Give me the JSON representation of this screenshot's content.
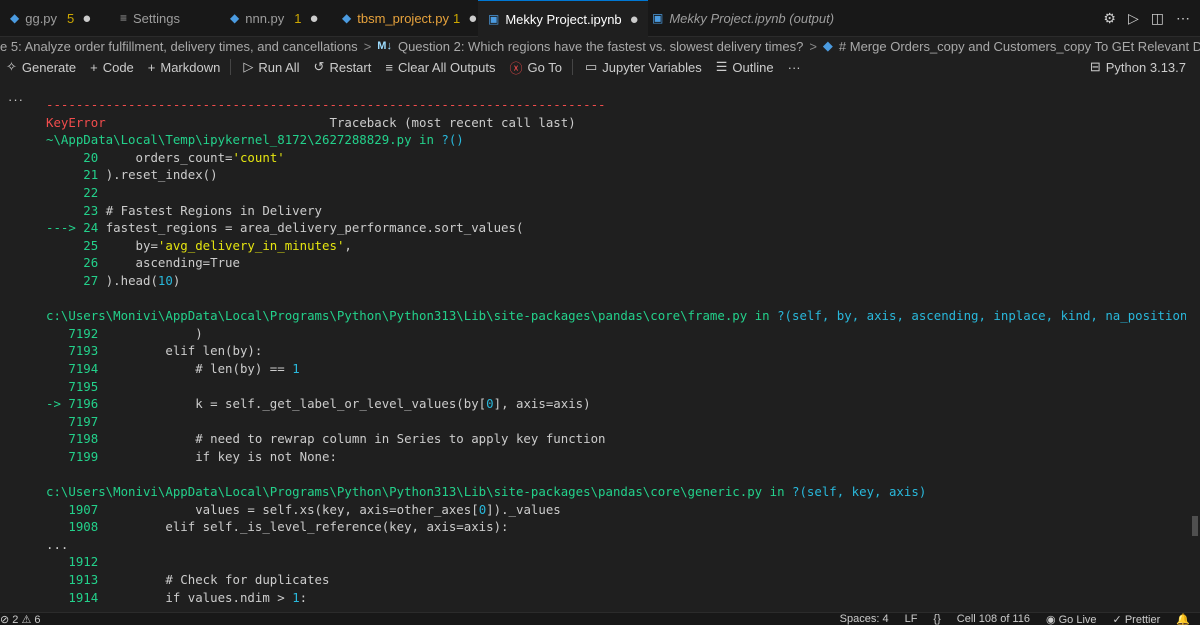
{
  "tabs": [
    {
      "label": "gg.py",
      "count": "5",
      "dot": "●",
      "icon": "python-icon",
      "active": false
    },
    {
      "label": "Settings",
      "icon": "settings-icon",
      "active": false
    },
    {
      "label": "nnn.py",
      "count": "1",
      "dot": "●",
      "icon": "python-icon",
      "active": false
    },
    {
      "label": "tbsm_project.py",
      "count": "1",
      "dot": "●",
      "icon": "python-icon",
      "active": false
    },
    {
      "label": "Mekky Project.ipynb",
      "dot": "●",
      "icon": "notebook-icon",
      "active": true
    },
    {
      "label": "Mekky Project.ipynb (output)",
      "icon": "notebook-icon",
      "active": false
    }
  ],
  "breadcrumb": {
    "part1": "e 5: Analyze order fulfillment, delivery times, and cancellations",
    "sep1": ">",
    "md_badge": "M↓",
    "part2": "Question 2:   Which regions have the fastest vs. slowest delivery times?",
    "sep2": ">",
    "part3": "# Merge Orders_copy and Customers_copy To GEt Relevant Data For The Analysis"
  },
  "toolbar": {
    "generate": "Generate",
    "code": "Code",
    "markdown": "Markdown",
    "run_all": "Run All",
    "restart": "Restart",
    "clear_outputs": "Clear All Outputs",
    "go_to": "Go To",
    "jupyter_variables": "Jupyter Variables",
    "outline": "Outline",
    "more": "···",
    "kernel": "Python 3.13.7"
  },
  "output": {
    "gutter": "···",
    "separator": "---------------------------------------------------------------------------",
    "error_name": "KeyError",
    "traceback_header": "Traceback (most recent call last)",
    "file1": {
      "path": "~\\AppData\\Local\\Temp\\ipykernel_8172\\2627288829.py",
      "in": "in",
      "func": "?()"
    },
    "block1": [
      {
        "no": "20",
        "text": "    orders_count='count'"
      },
      {
        "no": "21",
        "text": ").reset_index()"
      },
      {
        "no": "22",
        "text": ""
      },
      {
        "no": "23",
        "text": "# Fastest Regions in Delivery"
      },
      {
        "arrow": "---> ",
        "no": "24",
        "text": "fastest_regions = area_delivery_performance.sort_values("
      },
      {
        "no": "25",
        "text": "    by='avg_delivery_in_minutes',"
      },
      {
        "no": "26",
        "text": "    ascending=True"
      },
      {
        "no": "27",
        "text": ").head(10)"
      }
    ],
    "file2": {
      "path": "c:\\Users\\Monivi\\AppData\\Local\\Programs\\Python\\Python313\\Lib\\site-packages\\pandas\\core\\frame.py",
      "in": "in",
      "func": "?(self, by, axis, ascending, inplace, kind, na_position, ignore_"
    },
    "block2": [
      {
        "no": "7192",
        "text": "            )"
      },
      {
        "no": "7193",
        "text": "        elif len(by):"
      },
      {
        "no": "7194",
        "text": "            # len(by) == 1"
      },
      {
        "no": "7195",
        "text": ""
      },
      {
        "arrow": "-> ",
        "no": "7196",
        "text": "            k = self._get_label_or_level_values(by[0], axis=axis)"
      },
      {
        "no": "7197",
        "text": ""
      },
      {
        "no": "7198",
        "text": "            # need to rewrap column in Series to apply key function"
      },
      {
        "no": "7199",
        "text": "            if key is not None:"
      }
    ],
    "file3": {
      "path": "c:\\Users\\Monivi\\AppData\\Local\\Programs\\Python\\Python313\\Lib\\site-packages\\pandas\\core\\generic.py",
      "in": "in",
      "func": "?(self, key, axis)"
    },
    "block3": [
      {
        "no": "1907",
        "text": "            values = self.xs(key, axis=other_axes[0])._values"
      },
      {
        "no": "1908",
        "text": "        elif self._is_level_reference(key, axis=axis):"
      }
    ],
    "ellipsis": "...",
    "block4": [
      {
        "no": "1912",
        "text": ""
      },
      {
        "no": "1913",
        "text": "        # Check for duplicates"
      },
      {
        "no": "1914",
        "text": "        if values.ndim > 1:"
      }
    ]
  },
  "status": {
    "problems": "⊘ 2 ⚠ 6",
    "spaces": "Spaces: 4",
    "eol": "LF",
    "braces": "{}",
    "cell": "Cell 108 of 116",
    "golive": "Go Live",
    "prettier": "Prettier"
  },
  "colors": {
    "accent": "#0078d4",
    "error": "#f14c4c",
    "path_green": "#23d18b",
    "path_cyan": "#29b8db",
    "string_yellow": "#e5e510"
  }
}
